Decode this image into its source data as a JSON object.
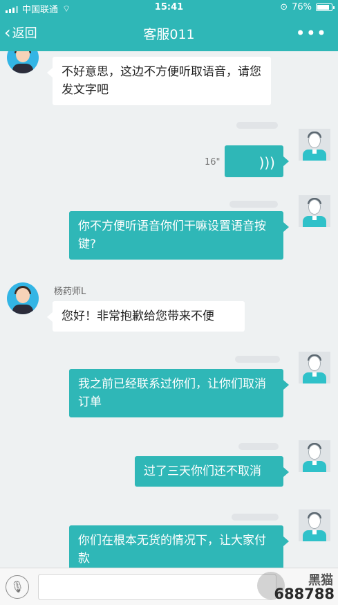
{
  "status_bar": {
    "carrier": "中国联通",
    "time": "15:41",
    "battery": "76%"
  },
  "nav": {
    "back_label": "返回",
    "title": "客服011",
    "more_label": "•••"
  },
  "messages": [
    {
      "side": "left",
      "text": "不好意思，这边不方便听取语音，请您发文字吧"
    },
    {
      "side": "right",
      "type": "voice",
      "duration": "16\""
    },
    {
      "side": "right",
      "text": "你不方便听语音你们干嘛设置语音按键?"
    },
    {
      "side": "left",
      "sender": "杨药师L",
      "text": "您好！非常抱歉给您带来不便"
    },
    {
      "side": "right",
      "text": "我之前已经联系过你们，让你们取消订单"
    },
    {
      "side": "right",
      "text": "过了三天你们还不取消"
    },
    {
      "side": "right",
      "text": "你们在根本无货的情况下，让大家付款"
    }
  ],
  "watermark": {
    "brand": "黑猫",
    "number": "688788"
  },
  "colors": {
    "accent": "#2fb7b7",
    "background": "#eef1f2"
  }
}
